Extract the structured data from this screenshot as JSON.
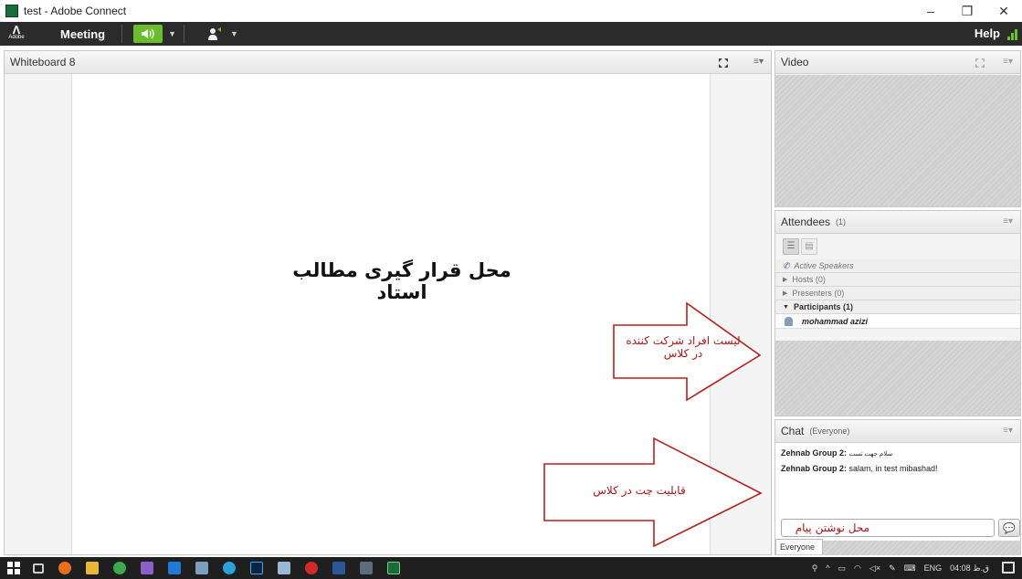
{
  "window": {
    "title": "test - Adobe Connect",
    "controls": {
      "minimize": "–",
      "restore": "❐",
      "close": "✕"
    }
  },
  "menubar": {
    "logo_top": "Λ",
    "logo_bottom": "Adobe",
    "meeting": "Meeting",
    "speaker_icon": "speaker-icon",
    "camera_icon": "camera-icon",
    "help": "Help"
  },
  "whiteboard": {
    "title": "Whiteboard 8",
    "main_text": "محل قرار گیری مطالب استاد"
  },
  "video": {
    "title": "Video"
  },
  "attendees": {
    "title": "Attendees",
    "count": "(1)",
    "active_speakers": "Active Speakers",
    "groups": [
      {
        "label": "Hosts (0)",
        "open": false
      },
      {
        "label": "Presenters (0)",
        "open": false
      },
      {
        "label": "Participants (1)",
        "open": true
      }
    ],
    "participants": [
      "mohammad azizi"
    ]
  },
  "chat": {
    "title": "Chat",
    "scope": "(Everyone)",
    "messages": [
      {
        "sender": "Zehnab Group 2:",
        "text": "سلام جهت تست"
      },
      {
        "sender": "Zehnab Group 2:",
        "text": "salam, in test mibashad!"
      }
    ],
    "input_label": "محل نوشتن پیام",
    "tab": "Everyone"
  },
  "annotations": {
    "attendees_note_line1": "لیست افراد شرکت کننده",
    "attendees_note_line2": "در کلاس",
    "chat_note": "قابلیت چت در کلاس",
    "color": "#a41717"
  },
  "taskbar": {
    "icons": [
      "windows-start-icon",
      "task-view-icon",
      "firefox-icon",
      "file-explorer-icon",
      "chrome-icon",
      "visual-studio-icon",
      "vscode-icon",
      "tool-icon",
      "telegram-icon",
      "photoshop-icon",
      "network-icon",
      "opera-icon",
      "word-icon",
      "app-icon",
      "adobe-connect-icon"
    ],
    "tray": {
      "language": "ENG",
      "time": "04:08 ق.ظ"
    }
  }
}
